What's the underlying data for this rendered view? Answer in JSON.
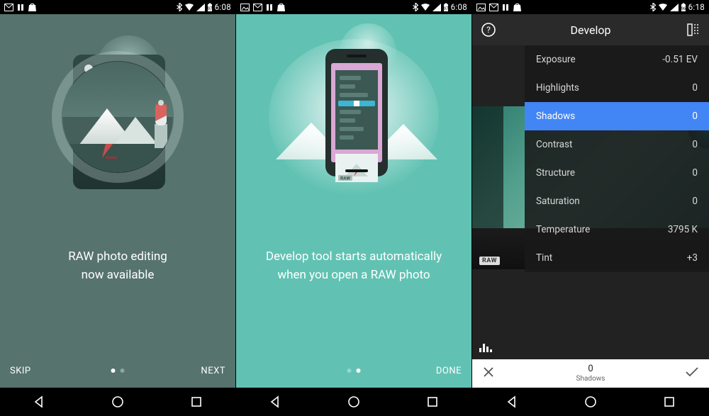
{
  "screens": [
    {
      "status": {
        "time": "6:08"
      },
      "caption_line1": "RAW photo editing",
      "caption_line2": "now available",
      "raw_badge": "RAW",
      "footer": {
        "left": "SKIP",
        "right": "NEXT",
        "page_active": 0
      }
    },
    {
      "status": {
        "time": "6:08"
      },
      "caption_line1": "Develop tool starts automatically",
      "caption_line2": "when you open a RAW photo",
      "raw_badge": "RAW",
      "footer": {
        "left": "",
        "right": "DONE",
        "page_active": 1
      }
    },
    {
      "status": {
        "time": "6:18"
      },
      "appbar_title": "Develop",
      "params": [
        {
          "label": "Exposure",
          "value": "-0.51 EV",
          "selected": false
        },
        {
          "label": "Highlights",
          "value": "0",
          "selected": false
        },
        {
          "label": "Shadows",
          "value": "0",
          "selected": true
        },
        {
          "label": "Contrast",
          "value": "0",
          "selected": false
        },
        {
          "label": "Structure",
          "value": "0",
          "selected": false
        },
        {
          "label": "Saturation",
          "value": "0",
          "selected": false
        },
        {
          "label": "Temperature",
          "value": "3795 K",
          "selected": false
        },
        {
          "label": "Tint",
          "value": "+3",
          "selected": false
        }
      ],
      "raw_badge": "RAW",
      "bottom": {
        "value": "0",
        "label": "Shadows"
      }
    }
  ]
}
